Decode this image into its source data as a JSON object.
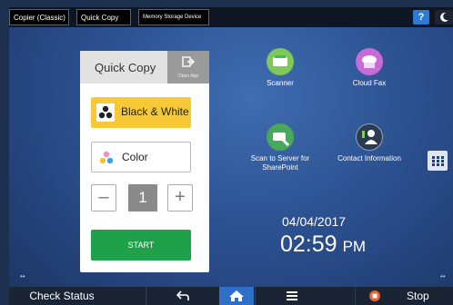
{
  "tabs": [
    "Copier (Classic)",
    "Quick Copy",
    "Memory Storage Device"
  ],
  "help_label": "?",
  "quick_copy": {
    "title": "Quick Copy",
    "open_app": "Open App",
    "bw_label": "Black & White",
    "color_label": "Color",
    "minus": "–",
    "qty": "1",
    "plus": "+",
    "start": "START"
  },
  "apps": [
    {
      "label": "Scanner",
      "icon": "scanner-icon",
      "color": "#7ec85a"
    },
    {
      "label": "Cloud Fax",
      "icon": "cloud-fax-icon",
      "color": "#c96ad8"
    },
    {
      "label": "Scan to Server for SharePoint",
      "icon": "scan-to-server-icon",
      "color": "#4aa85a"
    },
    {
      "label": "Contact Information",
      "icon": "contact-info-icon",
      "color": "#2a3b52"
    }
  ],
  "date": "04/04/2017",
  "time": "02:59",
  "ampm": "PM",
  "bottom": {
    "check_status": "Check Status",
    "stop": "Stop"
  }
}
